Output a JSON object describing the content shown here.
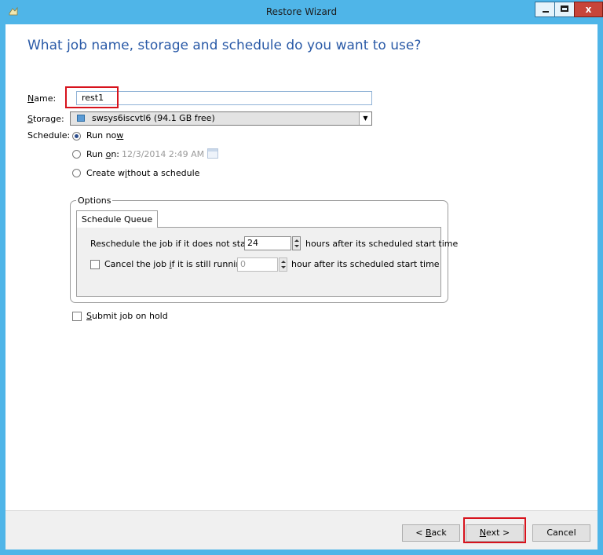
{
  "window": {
    "title": "Restore Wizard",
    "controls": {
      "minimize": "minimize",
      "maximize": "maximize",
      "close": "x"
    }
  },
  "page": {
    "heading": "What job name, storage and schedule do you want to use?"
  },
  "form": {
    "name": {
      "label_prefix": "N",
      "label_rest": "ame:",
      "value": "rest1"
    },
    "storage": {
      "label_prefix": "S",
      "label_rest": "torage:",
      "value": "swsys6iscvtl6 (94.1 GB free)"
    },
    "schedule": {
      "label": "Schedule:",
      "options": [
        {
          "text_pre": "Run no",
          "text_accel": "w",
          "text_post": "",
          "selected": true
        },
        {
          "text_pre": "Run ",
          "text_accel": "o",
          "text_post": "n:",
          "selected": false
        },
        {
          "text_pre": "Create w",
          "text_accel": "i",
          "text_post": "thout a schedule",
          "selected": false
        }
      ],
      "run_on_datetime": "12/3/2014 2:49 AM"
    }
  },
  "options": {
    "legend": "Options",
    "tab_label": "Schedule Queue",
    "reschedule": {
      "prefix": "Reschedule the job if it does not start",
      "value": "24",
      "suffix": "hours after its scheduled start time"
    },
    "cancel": {
      "prefix_pre": "Cancel the job ",
      "prefix_accel": "i",
      "prefix_post": "f it is still running",
      "value": "0",
      "suffix": "hour after its scheduled start time",
      "checked": false
    }
  },
  "submit_on_hold": {
    "text_accel": "S",
    "text_rest": "ubmit job on hold",
    "checked": false
  },
  "footer": {
    "back": {
      "pre": "< ",
      "accel": "B",
      "post": "ack"
    },
    "next": {
      "accel": "N",
      "post": "ext >"
    },
    "cancel": "Cancel"
  },
  "colors": {
    "titlebar": "#4fb5e8",
    "heading": "#2a5aa7",
    "highlight": "#d7131d"
  }
}
